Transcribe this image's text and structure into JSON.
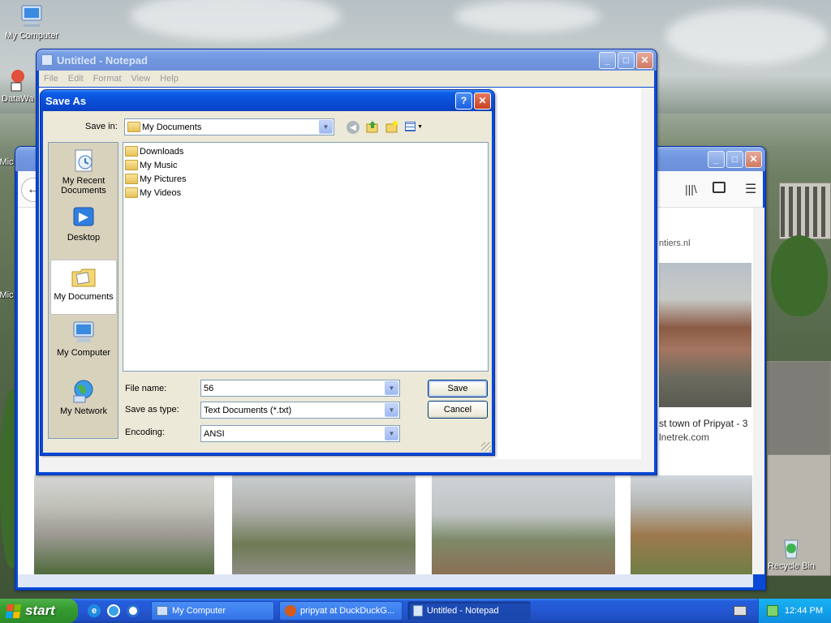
{
  "desktop": {
    "icons": [
      {
        "label": "My Computer"
      },
      {
        "label": "DataWa"
      },
      {
        "label": "Mic"
      },
      {
        "label": "Mic"
      },
      {
        "label": "Recycle Bin"
      }
    ]
  },
  "notepad": {
    "title": "Untitled - Notepad",
    "menu": [
      "File",
      "Edit",
      "Format",
      "View",
      "Help"
    ]
  },
  "browser": {
    "result_caption": "st town of Pripyat - 3",
    "result_source": "lnetrek.com",
    "result_partial": "ntiers.nl"
  },
  "dialog": {
    "title": "Save As",
    "save_in_label": "Save in:",
    "save_in_value": "My Documents",
    "places": [
      {
        "label": "My Recent Documents"
      },
      {
        "label": "Desktop"
      },
      {
        "label": "My Documents"
      },
      {
        "label": "My Computer"
      },
      {
        "label": "My Network"
      }
    ],
    "files": [
      "Downloads",
      "My Music",
      "My Pictures",
      "My Videos"
    ],
    "file_name_label": "File name:",
    "file_name_value": "56",
    "save_as_type_label": "Save as type:",
    "save_as_type_value": "Text Documents (*.txt)",
    "encoding_label": "Encoding:",
    "encoding_value": "ANSI",
    "save_button": "Save",
    "cancel_button": "Cancel",
    "help_glyph": "?"
  },
  "taskbar": {
    "start_label": "start",
    "tasks": [
      {
        "label": "My Computer"
      },
      {
        "label": "pripyat at DuckDuckG..."
      },
      {
        "label": "Untitled - Notepad"
      }
    ],
    "clock": "12:44 PM"
  },
  "colors": {
    "xp_blue": "#0a49d6",
    "dialog_face": "#ece9d8",
    "taskbar": "#245edb",
    "start_green": "#369c31"
  }
}
